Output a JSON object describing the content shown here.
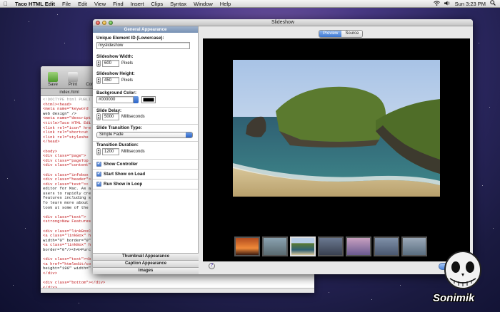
{
  "menubar": {
    "app_name": "Taco HTML Edit",
    "items": [
      "File",
      "Edit",
      "View",
      "Find",
      "Insert",
      "Clips",
      "Syntax",
      "Window",
      "Help"
    ],
    "clock": "Sun 3:23 PM"
  },
  "editor": {
    "toolbar": [
      "Save",
      "Print",
      "Compo"
    ],
    "tab": "index.html",
    "code_lines": [
      "<!DOCTYPE html PUBLI",
      "<html><head>",
      "<meta name=\"keyword",
      "web design\" />",
      "<meta name=\"descript",
      "<title>Taco HTML Edi",
      "<link rel=\"icon\" hre",
      "<link rel=\"shortcut",
      "<link rel=\"styleshe",
      "</head>",
      "",
      "<body>",
      "<div class=\"page\">",
      "<div class=\"pageTop",
      "<div class=\"content\"",
      "",
      "<div class=\"infobox",
      "<div class=\"header\">",
      "<div class=\"text\"><",
      "editor for Mac. As a",
      "users to rapidly cre",
      "features including s",
      "To learn more about",
      "look at some of the",
      "",
      "<div class=\"text\">",
      "<strong>New Features",
      "",
      "<div class=\"linkBoxC",
      "<a class=\"linkBox\" h",
      "width=\"0\" border=\"0\"",
      "<a class=\"linkBox\" h",
      "border=\"0\"/><h4>Purc",
      "",
      "<div class=\"text\"><b",
      "<a href=\"htmledit/co",
      "height=\"190\" width=\"",
      "</div>",
      "",
      "<div class=\"bottom\"></div>",
      "</div>"
    ]
  },
  "window": {
    "title": "Slideshow",
    "panel": {
      "header": "General Appearance",
      "unique_id_label": "Unique Element ID (Lowercase):",
      "unique_id_value": "myslideshow",
      "width_label": "Slideshow Width:",
      "width_value": "600",
      "width_unit": "Pixels",
      "height_label": "Slideshow Height:",
      "height_value": "450",
      "height_unit": "Pixels",
      "bg_label": "Background Color:",
      "bg_value": "#000000",
      "delay_label": "Slide Delay:",
      "delay_value": "5000",
      "delay_unit": "Milliseconds",
      "transition_label": "Slide Transition Type:",
      "transition_value": "Simple Fade",
      "duration_label": "Transition Duration:",
      "duration_value": "1200",
      "duration_unit": "Milliseconds",
      "check_controller": "Show Controller",
      "check_start": "Start Show on Load",
      "check_loop": "Run Show in Loop",
      "sections": [
        "Thumbnail Appearance",
        "Caption Appearance",
        "Images"
      ]
    },
    "view_tabs": [
      "Preview",
      "Source"
    ],
    "active_view": "Preview",
    "help_label": "?"
  },
  "colors": {
    "accent_blue": "#3b76d2",
    "panel_header": "#7891b4",
    "code_red": "#c0171b",
    "stage_bg": "#000000"
  },
  "watermark": {
    "text": "Sonimik"
  }
}
